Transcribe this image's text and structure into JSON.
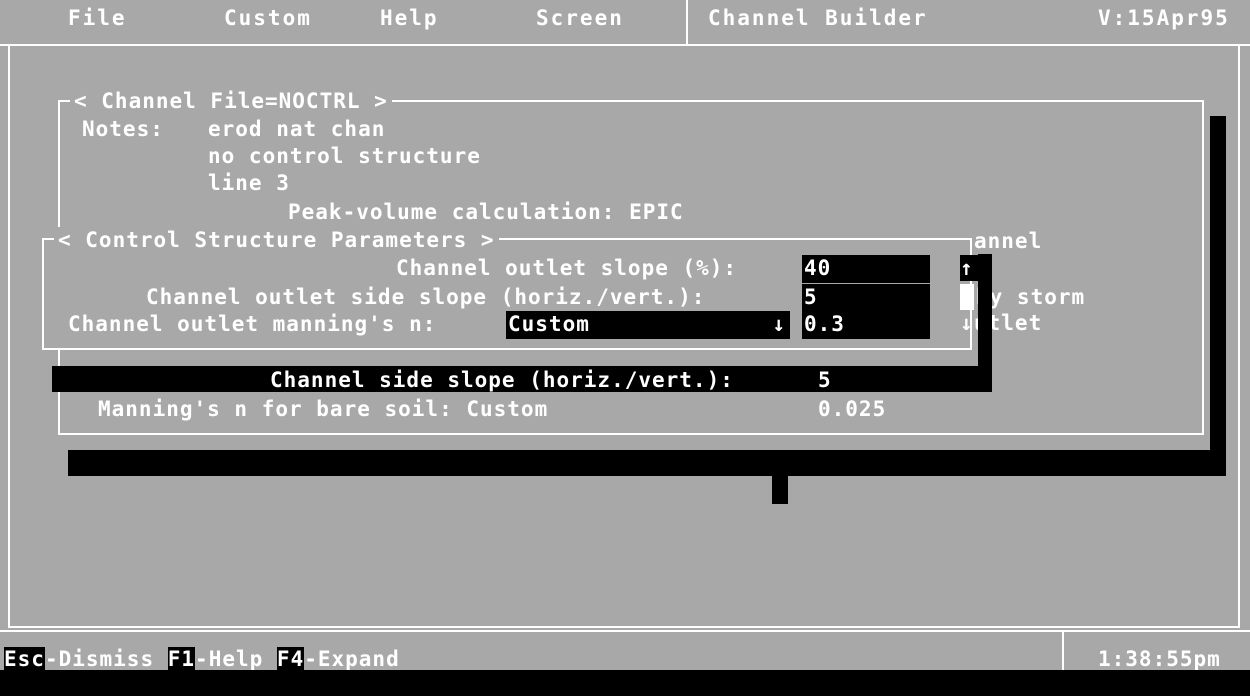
{
  "menubar": {
    "items": [
      "File",
      "Custom",
      "Help",
      "Screen"
    ],
    "title": "Channel Builder",
    "version": "V:15Apr95"
  },
  "channel_file": {
    "title": "< Channel File=NOCTRL >",
    "notes_label": "Notes:",
    "notes": [
      "erod nat chan",
      "no control structure",
      "line 3"
    ],
    "peak_volume": "Peak-volume calculation: EPIC",
    "frag_channel": "annel",
    "frag_storm": "by storm",
    "frag_outlet": "utlet",
    "side_slope_label": "Channel side slope (horiz./vert.):",
    "side_slope_value": "5",
    "manning_bare_label": "Manning's n for bare soil: Custom",
    "manning_bare_value": "0.025"
  },
  "control_structure": {
    "title": "< Control Structure Parameters >",
    "outlet_slope_label": "Channel outlet slope (%):",
    "outlet_slope_value": "40",
    "outlet_side_slope_label": "Channel outlet side slope (horiz./vert.):",
    "outlet_side_slope_value": "5",
    "outlet_manning_label": "Channel outlet manning's n:",
    "outlet_manning_select": "Custom",
    "outlet_manning_value": "0.3"
  },
  "scroll": {
    "up": "↑",
    "down": "↓"
  },
  "statusbar": {
    "esc_key": "Esc",
    "esc_text": "-Dismiss",
    "f1_key": "F1",
    "f1_text": "-Help",
    "f4_key": "F4",
    "f4_text": "-Expand",
    "clock": "1:38:55pm"
  }
}
